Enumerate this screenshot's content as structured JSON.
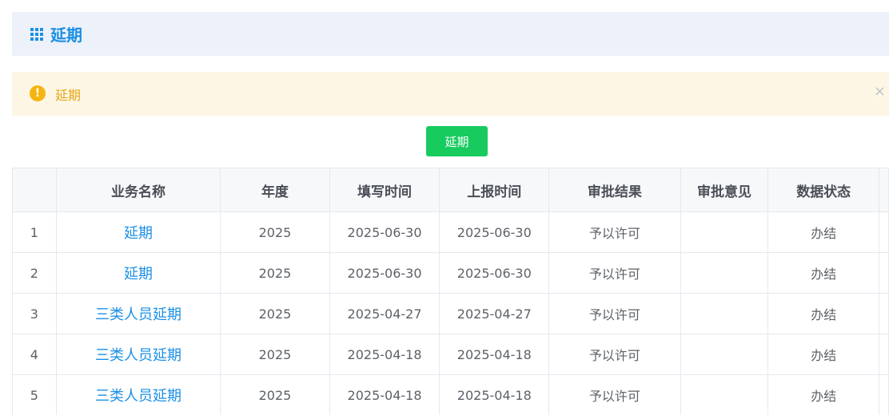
{
  "header": {
    "title": "延期",
    "icon": "grid-icon",
    "accent_color": "#1a8fe6"
  },
  "alert": {
    "icon": "warning-icon",
    "text": "延期",
    "close_symbol": "×",
    "text_color": "#e6a817"
  },
  "toolbar": {
    "extend_label": "延期",
    "button_color": "#18cb5f"
  },
  "table": {
    "columns": [
      "",
      "业务名称",
      "年度",
      "填写时间",
      "上报时间",
      "审批结果",
      "审批意见",
      "数据状态"
    ],
    "rows": [
      {
        "index": "1",
        "name": "延期",
        "year": "2025",
        "fill_time": "2025-06-30",
        "report_time": "2025-06-30",
        "result": "予以许可",
        "opinion": "",
        "status": "办结"
      },
      {
        "index": "2",
        "name": "延期",
        "year": "2025",
        "fill_time": "2025-06-30",
        "report_time": "2025-06-30",
        "result": "予以许可",
        "opinion": "",
        "status": "办结"
      },
      {
        "index": "3",
        "name": "三类人员延期",
        "year": "2025",
        "fill_time": "2025-04-27",
        "report_time": "2025-04-27",
        "result": "予以许可",
        "opinion": "",
        "status": "办结"
      },
      {
        "index": "4",
        "name": "三类人员延期",
        "year": "2025",
        "fill_time": "2025-04-18",
        "report_time": "2025-04-18",
        "result": "予以许可",
        "opinion": "",
        "status": "办结"
      },
      {
        "index": "5",
        "name": "三类人员延期",
        "year": "2025",
        "fill_time": "2025-04-18",
        "report_time": "2025-04-18",
        "result": "予以许可",
        "opinion": "",
        "status": "办结"
      }
    ]
  }
}
